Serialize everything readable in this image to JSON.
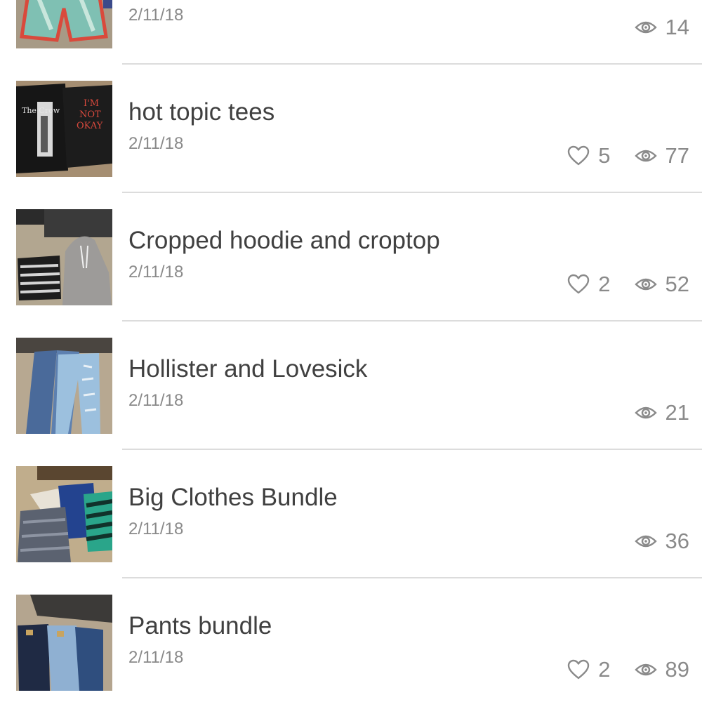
{
  "listings": [
    {
      "title": "",
      "date": "2/11/18",
      "likes": null,
      "views": "14",
      "photo": "shorts-icon"
    },
    {
      "title": "hot topic tees",
      "date": "2/11/18",
      "likes": "5",
      "views": "77",
      "photo": "tees-icon"
    },
    {
      "title": "Cropped hoodie and croptop",
      "date": "2/11/18",
      "likes": "2",
      "views": "52",
      "photo": "hoodie-icon"
    },
    {
      "title": "Hollister and Lovesick",
      "date": "2/11/18",
      "likes": null,
      "views": "21",
      "photo": "jeans-icon"
    },
    {
      "title": "Big Clothes Bundle",
      "date": "2/11/18",
      "likes": null,
      "views": "36",
      "photo": "clothes-bundle-icon"
    },
    {
      "title": "Pants bundle",
      "date": "2/11/18",
      "likes": "2",
      "views": "89",
      "photo": "pants-icon"
    }
  ],
  "colors": {
    "title": "#404040",
    "meta": "#8a8a8a",
    "divider": "#dcdcdc"
  }
}
